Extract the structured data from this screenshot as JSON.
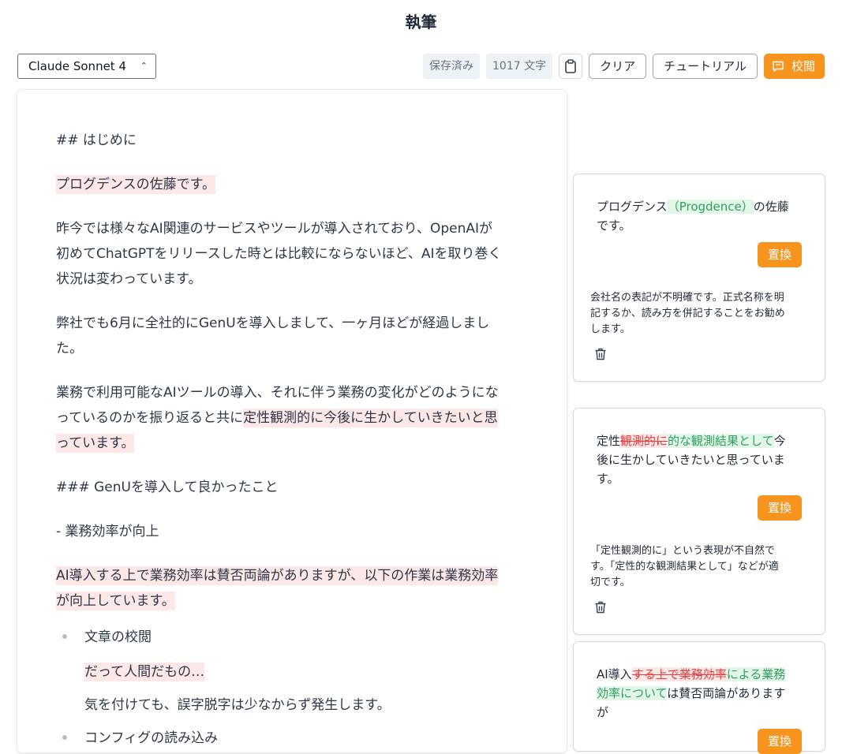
{
  "header": {
    "title": "執筆"
  },
  "toolbar": {
    "model": "Claude Sonnet 4",
    "saved_label": "保存済み",
    "char_count": "1017 文字",
    "clear_label": "クリア",
    "tutorial_label": "チュートリアル",
    "proofread_label": "校閲"
  },
  "document": {
    "p1": "## はじめに",
    "p2": "プログデンスの佐藤です。",
    "p3_l1": "昨今では様々なAI関連のサービスやツールが導入されており、OpenAIが",
    "p3_l2": "初めてChatGPTをリリースした時とは比較にならないほど、AIを取り巻く",
    "p3_l3": "状況は変わっています。",
    "p4_l1": "弊社でも6月に全社的にGenUを導入しまして、一ヶ月ほどが経過しまし",
    "p4_l2": "た。",
    "p5_l1": "業務で利用可能なAIツールの導入、それに伴う業務の変化がどのようにな",
    "p5_l2a": "っているのかを振り返ると共に",
    "p5_l2b": "定性観測的に今後に生かしていきたいと思",
    "p5_l3": "っています。",
    "p6": "### GenUを導入して良かったこと",
    "p7": "- 業務効率が向上",
    "p8_l1a": "AI導入する上で業務効率は賛否両論がありますが、",
    "p8_l1b": "以下の作業は業務効率",
    "p8_l2": "が向上しています。",
    "b1": "文章の校閲",
    "b1_sub1": "だって人間だもの…",
    "b1_sub2": "気を付けても、誤字脱字は少なからず発生します。",
    "b2": "コンフィグの読み込み"
  },
  "suggestions": [
    {
      "before": "プログデンス",
      "deleted": "",
      "inserted": "（Progdence）",
      "after_l1": "の佐藤",
      "after_l2": "です。",
      "replace_label": "置換",
      "desc_l1": "会社名の表記が不明確です。正式名称を明",
      "desc_l2": "記するか、読み方を併記することをお勧め",
      "desc_l3": "します。"
    },
    {
      "before": "定性",
      "deleted": "観測的に",
      "inserted": "的な観測結果として",
      "after_l1": "今",
      "after_l2": "後に生かしていきたいと思っていま",
      "after_l3": "す。",
      "replace_label": "置換",
      "desc_l1": "「定性観測的に」という表現が不自然で",
      "desc_l2": "す。「定性的な観測結果として」などが適",
      "desc_l3": "切です。"
    },
    {
      "before": "AI導入",
      "deleted": "する上で業務効率",
      "inserted_l1": "による業務",
      "inserted_l2": "効率について",
      "after_l2": "は賛否両論がありま",
      "after_l2b": "す",
      "after_l3": "が",
      "replace_label": "置換"
    }
  ],
  "colors": {
    "accent": "#f7941d",
    "highlight": "#fde8e8",
    "insert": "#2f9e5e",
    "delete": "#e53e3e"
  }
}
